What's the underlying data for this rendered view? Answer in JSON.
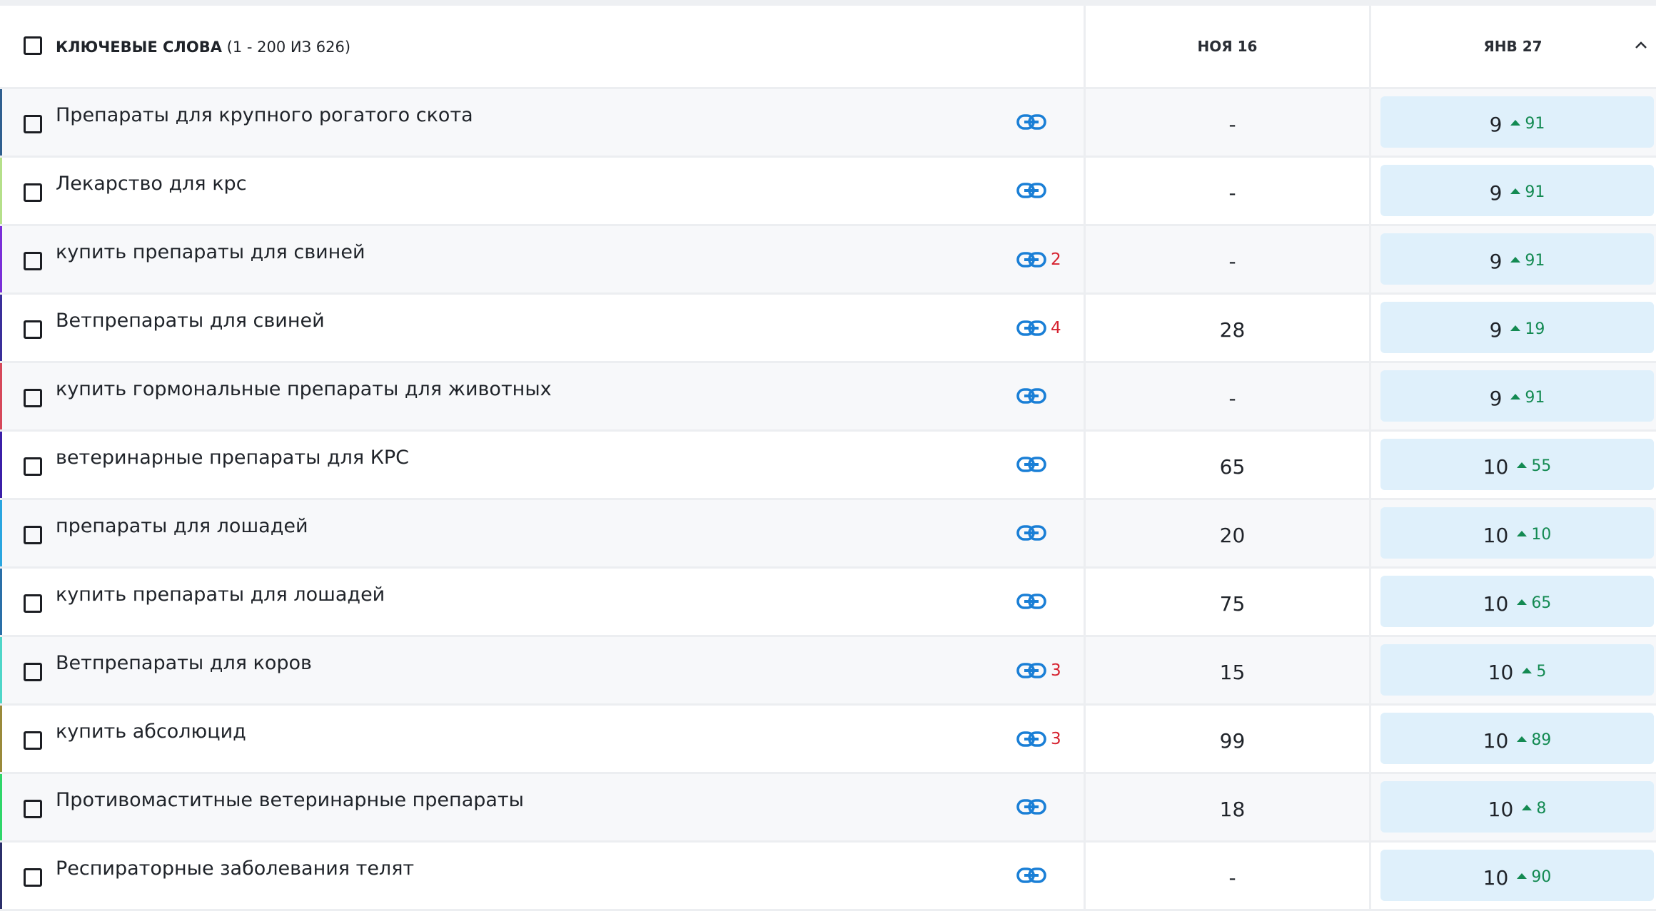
{
  "header": {
    "keywords_label": "КЛЮЧЕВЫЕ СЛОВА",
    "range_label": "(1 - 200 ИЗ 626)",
    "col_nov": "НОЯ 16",
    "col_jan": "ЯНВ 27"
  },
  "rows": [
    {
      "keyword": "Препараты для крупного рогатого скота",
      "links": "",
      "nov": "-",
      "jan": "9",
      "change": "91",
      "accent": "#2f5f8f"
    },
    {
      "keyword": "Лекарство для крс",
      "links": "",
      "nov": "-",
      "jan": "9",
      "change": "91",
      "accent": "#b5e08a"
    },
    {
      "keyword": "купить препараты для свиней",
      "links": "2",
      "nov": "-",
      "jan": "9",
      "change": "91",
      "accent": "#7b2fd8"
    },
    {
      "keyword": "Ветпрепараты для свиней",
      "links": "4",
      "nov": "28",
      "jan": "9",
      "change": "19",
      "accent": "#3a2f9a"
    },
    {
      "keyword": "купить гормональные препараты для животных",
      "links": "",
      "nov": "-",
      "jan": "9",
      "change": "91",
      "accent": "#d6485a"
    },
    {
      "keyword": "ветеринарные препараты для КРС",
      "links": "",
      "nov": "65",
      "jan": "10",
      "change": "55",
      "accent": "#3b1fa8"
    },
    {
      "keyword": "препараты для лошадей",
      "links": "",
      "nov": "20",
      "jan": "10",
      "change": "10",
      "accent": "#2aa6e0"
    },
    {
      "keyword": "купить препараты для лошадей",
      "links": "",
      "nov": "75",
      "jan": "10",
      "change": "65",
      "accent": "#2a6fa8"
    },
    {
      "keyword": "Ветпрепараты для коров",
      "links": "3",
      "nov": "15",
      "jan": "10",
      "change": "5",
      "accent": "#4fd6c8"
    },
    {
      "keyword": "купить абсолюцид",
      "links": "3",
      "nov": "99",
      "jan": "10",
      "change": "89",
      "accent": "#9a8a3a"
    },
    {
      "keyword": "Противомаститные ветеринарные препараты",
      "links": "",
      "nov": "18",
      "jan": "10",
      "change": "8",
      "accent": "#2fd66a"
    },
    {
      "keyword": "Респираторные заболевания телят",
      "links": "",
      "nov": "-",
      "jan": "10",
      "change": "90",
      "accent": "#2b2f6a"
    }
  ],
  "colors": {
    "link_blue": "#1a7fd6",
    "up_green": "#138a52",
    "link_count_red": "#d6222f",
    "cell_bg": "#dff0fb"
  }
}
